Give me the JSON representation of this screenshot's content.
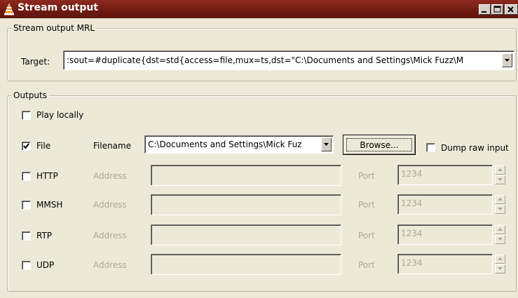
{
  "window": {
    "title": "Stream output",
    "icon": "vlc-cone-icon",
    "controls": [
      "minimize-icon",
      "maximize-icon",
      "close-icon"
    ]
  },
  "mrl": {
    "group_title": "Stream output MRL",
    "target_label": "Target:",
    "target_value": ":sout=#duplicate{dst=std{access=file,mux=ts,dst=\"C:\\Documents and Settings\\Mick Fuzz\\M"
  },
  "outputs": {
    "group_title": "Outputs",
    "play_locally": {
      "label": "Play locally",
      "checked": false
    },
    "file": {
      "label": "File",
      "checked": true,
      "filename_label": "Filename",
      "filename_value": "C:\\Documents and Settings\\Mick Fuz",
      "browse_label": "Browse...",
      "dump_raw_label": "Dump raw input",
      "dump_raw_checked": false
    },
    "network": [
      {
        "label": "HTTP",
        "checked": false,
        "address_label": "Address",
        "address_value": "",
        "port_label": "Port",
        "port_value": "1234"
      },
      {
        "label": "MMSH",
        "checked": false,
        "address_label": "Address",
        "address_value": "",
        "port_label": "Port",
        "port_value": "1234"
      },
      {
        "label": "RTP",
        "checked": false,
        "address_label": "Address",
        "address_value": "",
        "port_label": "Port",
        "port_value": "1234"
      },
      {
        "label": "UDP",
        "checked": false,
        "address_label": "Address",
        "address_value": "",
        "port_label": "Port",
        "port_value": "1234"
      }
    ]
  },
  "colors": {
    "titlebar": "#7a1f16",
    "dialog_bg": "#ece9d8",
    "disabled_text": "#aca899"
  }
}
